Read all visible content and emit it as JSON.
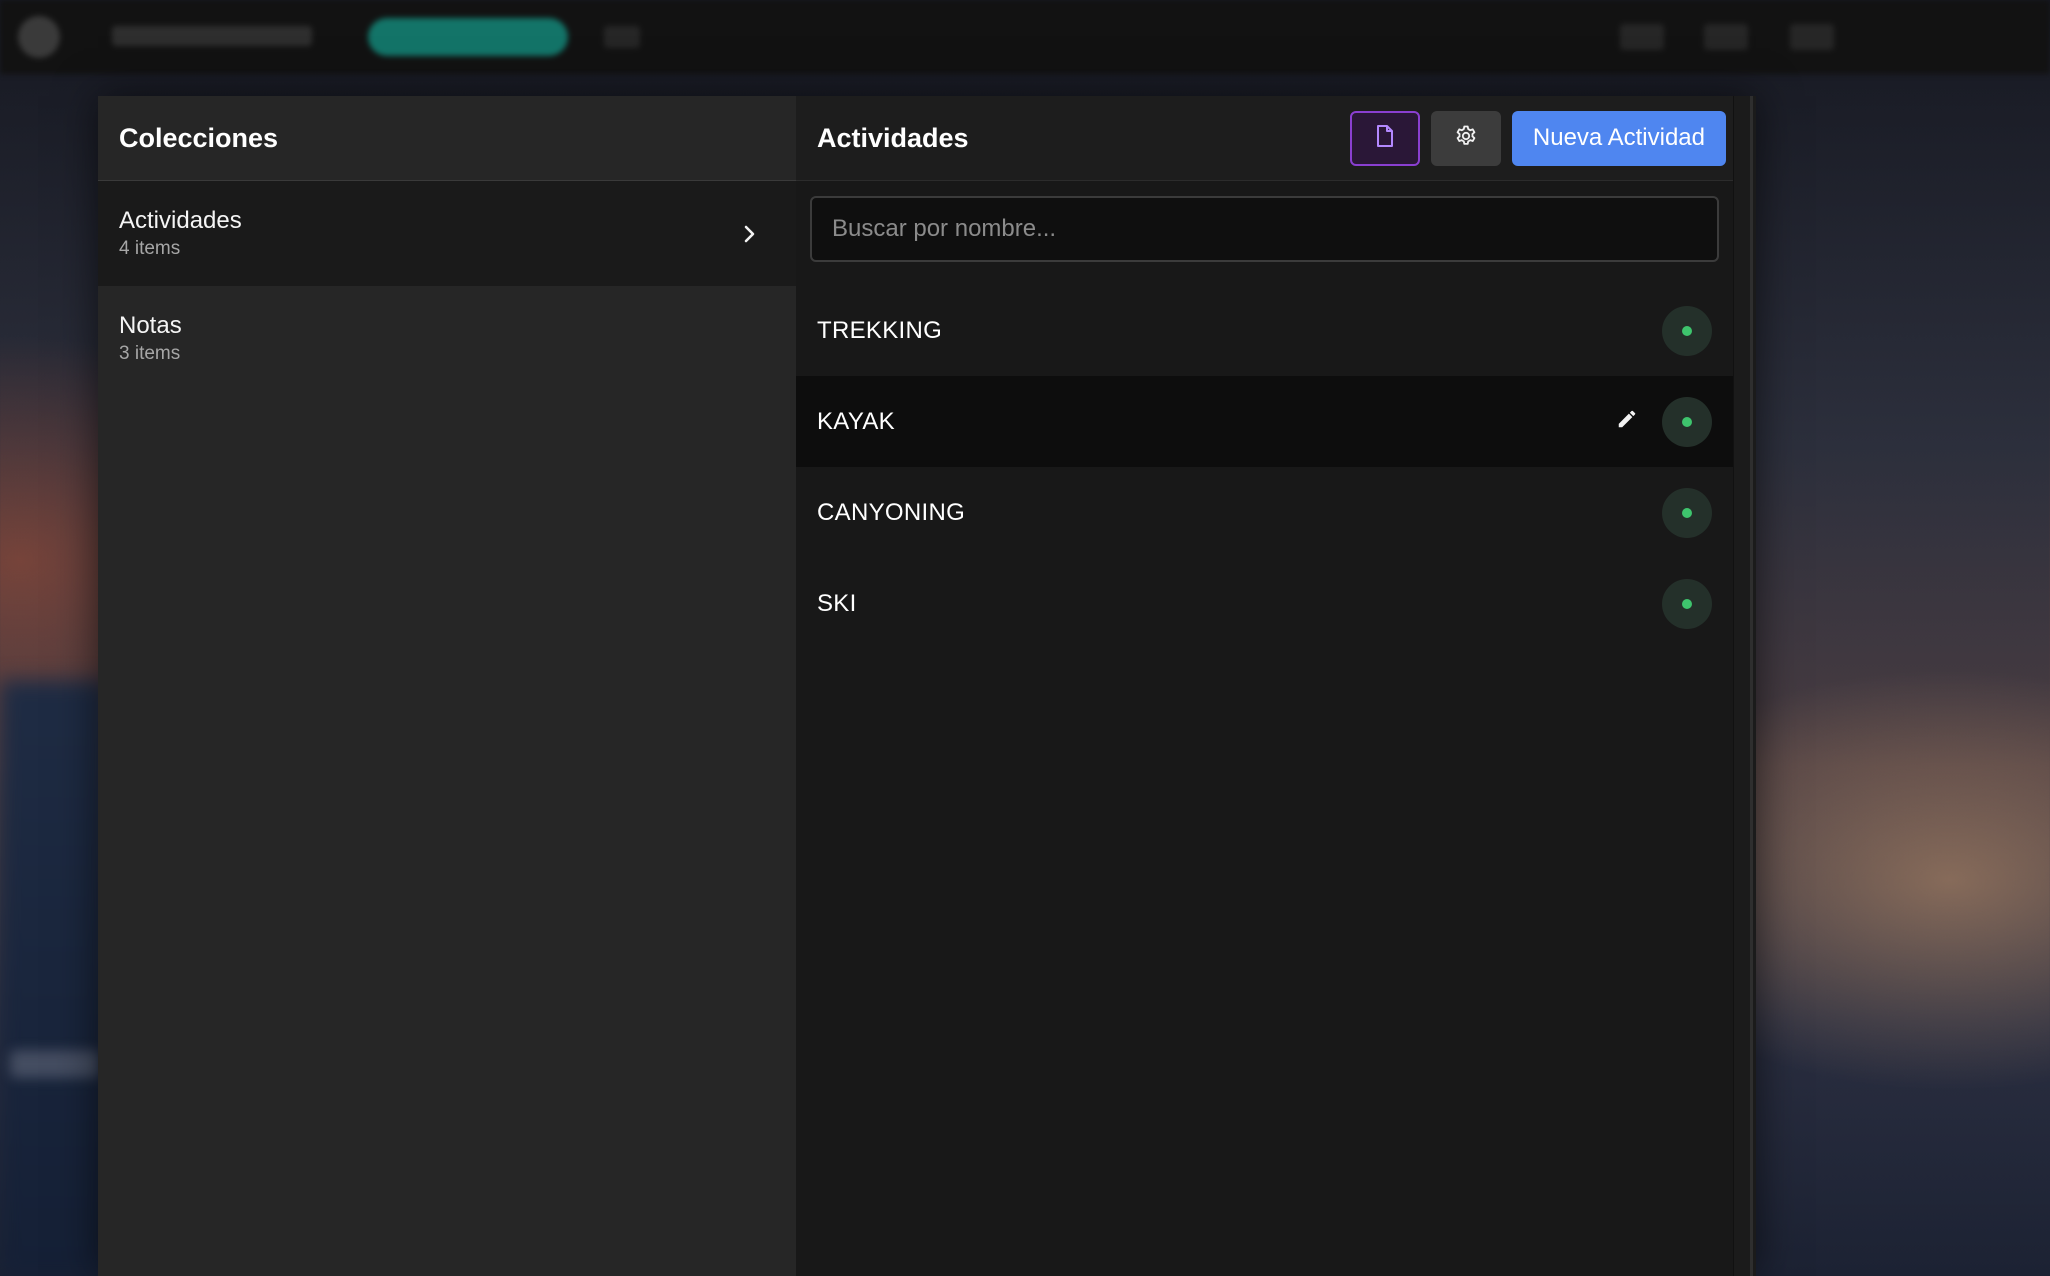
{
  "colors": {
    "accent_primary": "#4f86f0",
    "accent_doc": "#8a3fd1",
    "status_active": "#3ec46d"
  },
  "collections": {
    "title": "Colecciones",
    "items": [
      {
        "name": "Actividades",
        "count": "4 items",
        "active": true,
        "icon": "chevron-right-icon"
      },
      {
        "name": "Notas",
        "count": "3 items",
        "active": false
      }
    ]
  },
  "activities": {
    "title": "Actividades",
    "new_button": "Nueva Actividad",
    "doc_icon": "document-icon",
    "settings_icon": "gear-icon",
    "search": {
      "placeholder": "Buscar por nombre...",
      "value": ""
    },
    "items": [
      {
        "name": "TREKKING",
        "status": "active"
      },
      {
        "name": "KAYAK",
        "status": "active",
        "hovered": true,
        "edit_icon": "pencil-icon"
      },
      {
        "name": "CANYONING",
        "status": "active"
      },
      {
        "name": "SKI",
        "status": "active"
      }
    ]
  }
}
